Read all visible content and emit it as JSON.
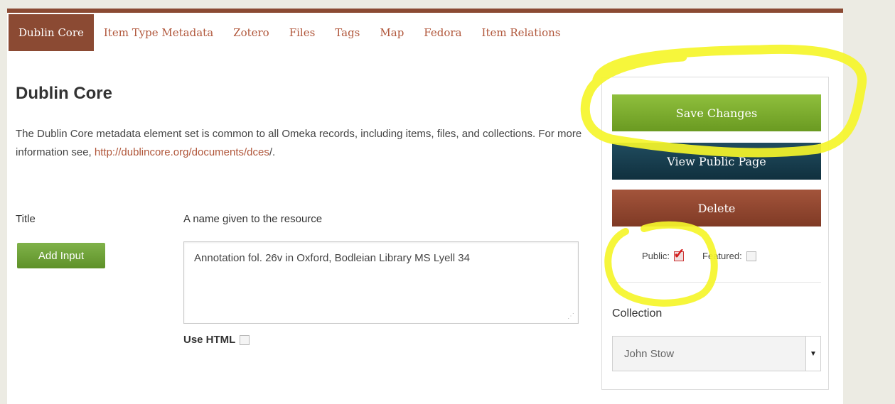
{
  "tabs": [
    {
      "label": "Dublin Core",
      "active": true
    },
    {
      "label": "Item Type Metadata",
      "active": false
    },
    {
      "label": "Zotero",
      "active": false
    },
    {
      "label": "Files",
      "active": false
    },
    {
      "label": "Tags",
      "active": false
    },
    {
      "label": "Map",
      "active": false
    },
    {
      "label": "Fedora",
      "active": false
    },
    {
      "label": "Item Relations",
      "active": false
    }
  ],
  "section": {
    "title": "Dublin Core",
    "description_before": "The Dublin Core metadata element set is common to all Omeka records, including items, files, and collections. For more information see, ",
    "description_link": "http://dublincore.org/documents/dces",
    "description_after": "/."
  },
  "field": {
    "label": "Title",
    "hint": "A name given to the resource",
    "add_input_label": "Add Input",
    "value": "Annotation fol. 26v in Oxford, Bodleian Library MS Lyell 34",
    "use_html_label": "Use HTML"
  },
  "sidebar": {
    "save_label": "Save Changes",
    "view_label": "View Public Page",
    "delete_label": "Delete",
    "public_label": "Public:",
    "featured_label": "Featured:",
    "public_checked": true,
    "featured_checked": false,
    "collection_label": "Collection",
    "collection_value": "John Stow"
  },
  "colors": {
    "accent_brown": "#8b4a33",
    "link": "#b0563a",
    "save_green": "#7aa82c",
    "view_navy": "#16394a",
    "delete_brown": "#8f452e",
    "highlight": "#f5f52a",
    "check_red": "#d41c1c"
  }
}
